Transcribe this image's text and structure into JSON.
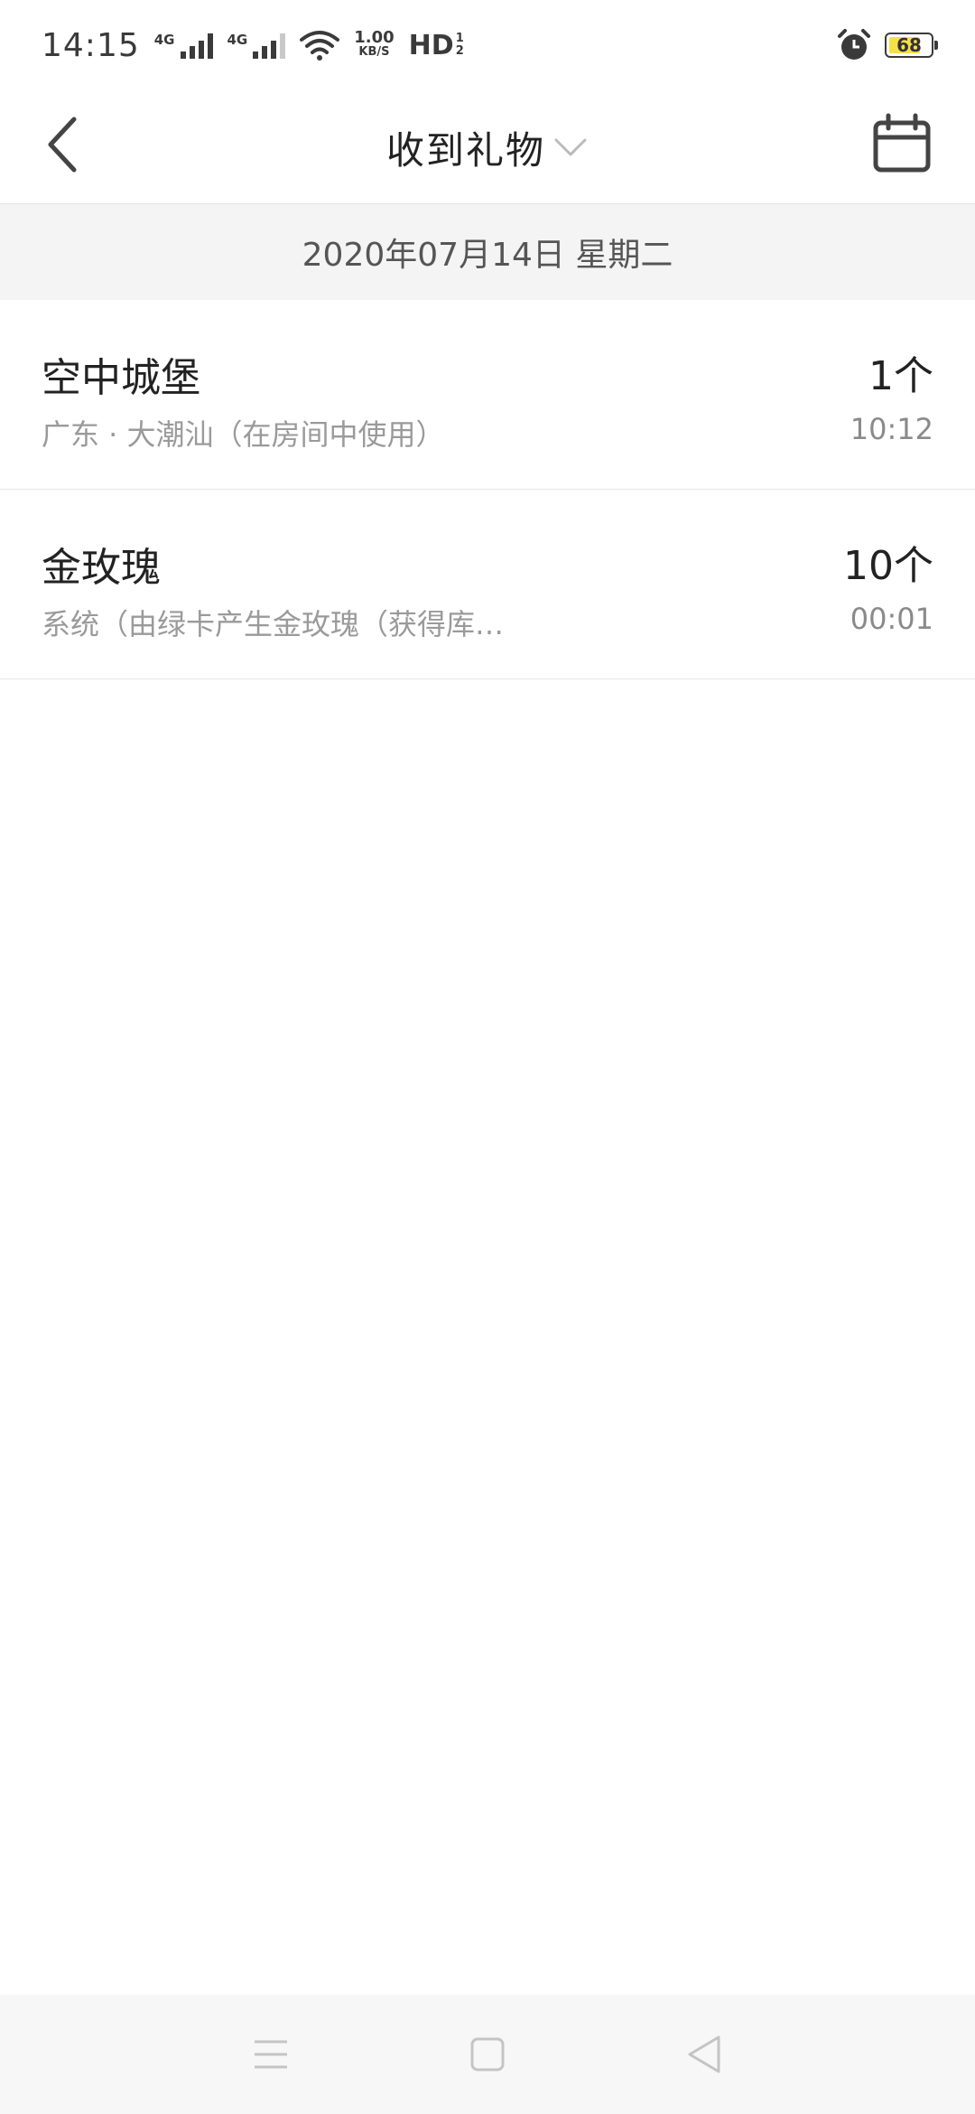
{
  "status_bar": {
    "time": "14:15",
    "network_1": "4G",
    "network_2": "4G",
    "speed_value": "1.00",
    "speed_unit": "KB/S",
    "hd": "HD",
    "hd_sub_top": "1",
    "hd_sub_bottom": "2",
    "battery": "68",
    "battery_color": "#f5e04a"
  },
  "header": {
    "title": "收到礼物"
  },
  "date_bar": {
    "date": "2020年07月14日 星期二"
  },
  "gifts": [
    {
      "name": "空中城堡",
      "desc": "广东 · 大潮汕（在房间中使用）",
      "qty": "1个",
      "time": "10:12"
    },
    {
      "name": "金玫瑰",
      "desc": "系统（由绿卡产生金玫瑰（获得库…",
      "qty": "10个",
      "time": "00:01"
    }
  ],
  "icons": {
    "back": "chevron-left-icon",
    "dropdown": "chevron-down-icon",
    "calendar": "calendar-icon",
    "menu": "menu-icon",
    "home": "home-square-icon",
    "back_nav": "back-triangle-icon"
  }
}
